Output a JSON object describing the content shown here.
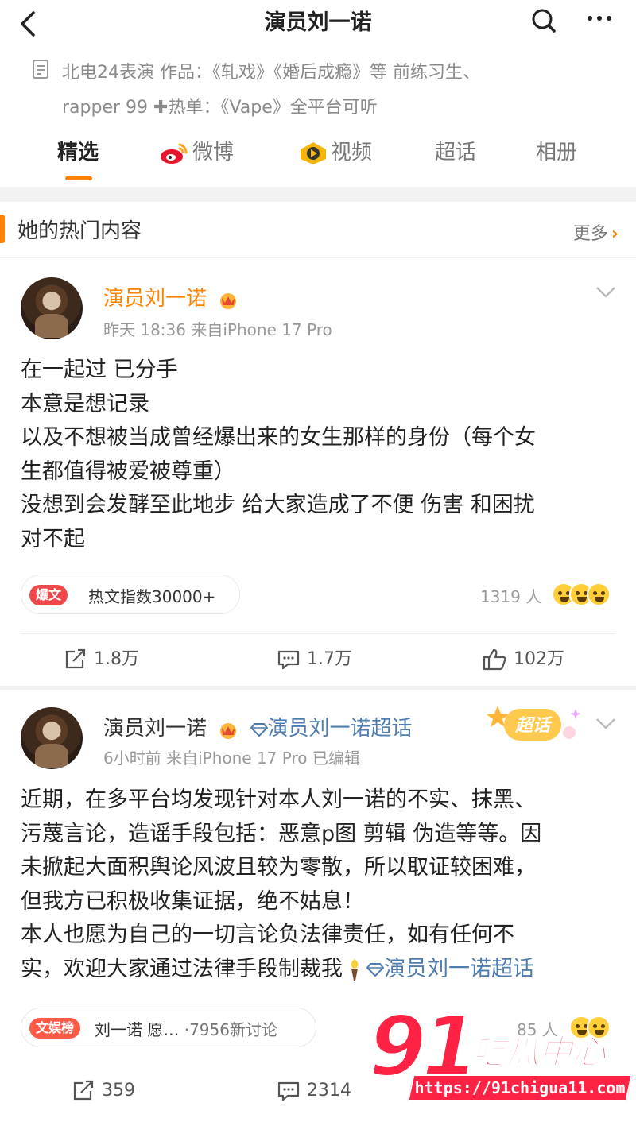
{
  "header": {
    "title": "演员刘一诺"
  },
  "profile": {
    "bio_line1": "北电24表演 作品：《轧戏》《婚后成瘾》等 前练习生、",
    "bio_line2": "rapper 99 ✚热单：《Vape》全平台可听"
  },
  "tabs": [
    {
      "label": "精选"
    },
    {
      "label": "微博"
    },
    {
      "label": "视频"
    },
    {
      "label": "超话"
    },
    {
      "label": "相册"
    }
  ],
  "hot_section": {
    "title": "她的热门内容",
    "more_label": "更多"
  },
  "posts": [
    {
      "author": "演员刘一诺",
      "meta": "昨天 18:36  来自iPhone 17 Pro",
      "lines": [
        "在一起过 已分手",
        "本意是想记录",
        "以及不想被当成曾经爆出来的女生那样的身份（每个女",
        "生都值得被爱被尊重）",
        "没想到会发酵至此地步 给大家造成了不便 伤害 和困扰",
        "对不起"
      ],
      "pill_badge": "爆文",
      "pill_text": "热文指数30000+",
      "reactions_count": "1319 人",
      "reposts": "1.8万",
      "comments": "1.7万",
      "likes": "102万"
    },
    {
      "author": "演员刘一诺",
      "super_topic": "演员刘一诺超话",
      "supertopic_badge": "超话",
      "meta": "6小时前  来自iPhone 17 Pro  已编辑",
      "lines": [
        "近期，在多平台均发现针对本人刘一诺的不实、抹黑、",
        "污蔑言论，造谣手段包括：恶意p图 剪辑 伪造等等。因",
        "未掀起大面积舆论风波且较为零散，所以取证较困难，",
        "但我方已积极收集证据，绝不姑息！",
        "本人也愿为自己的一切言论负法律责任，如有任何不",
        "实，欢迎大家通过法律手段制裁我"
      ],
      "inline_topic": "演员刘一诺超话",
      "pill_badge": "文娱榜",
      "pill_text": "刘一诺 愿…",
      "pill_sub": "·7956新讨论",
      "reactions_count": "85 人",
      "reposts": "359",
      "comments": "2314"
    }
  ],
  "watermark": {
    "number": "91",
    "name": "吃瓜中心",
    "url": "https://91chigua11.com"
  },
  "colors": {
    "accent": "#ff8200",
    "link": "#507daf",
    "watermark": "#ff2244"
  }
}
